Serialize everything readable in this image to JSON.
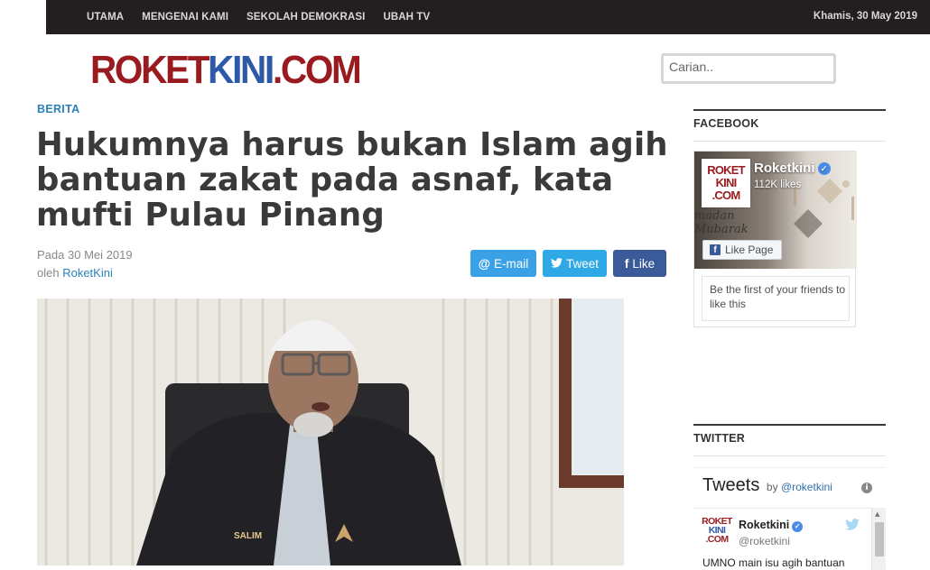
{
  "topbar": {
    "nav": [
      "UTAMA",
      "MENGENAI KAMI",
      "SEKOLAH DEMOKRASI",
      "UBAH TV"
    ],
    "date": "Khamis, 30 May 2019"
  },
  "logo": {
    "part1": "ROKET",
    "part2": "KINI",
    "part3": ".COM"
  },
  "search": {
    "placeholder": "Carian.."
  },
  "article": {
    "category": "BERITA",
    "title": "Hukumnya harus bukan Islam agih bantuan zakat pada asnaf, kata mufti Pulau Pinang",
    "date_prefix": "Pada",
    "date": "30 Mei 2019",
    "author_prefix": "oleh",
    "author": "RoketKini",
    "share": {
      "email": "E-mail",
      "tweet": "Tweet",
      "like": "Like"
    },
    "photo_caption_text": "SALIM"
  },
  "sidebar": {
    "facebook": {
      "heading": "FACEBOOK",
      "page_name": "Roketkini",
      "likes": "112K likes",
      "cover_text": "madan\nMubarak",
      "avatar_line1": "ROKET",
      "avatar_line2": "KINI",
      "avatar_line3": ".COM",
      "like_button": "Like Page",
      "first_friends": "Be the first of your friends to like this"
    },
    "twitter": {
      "heading": "TWITTER",
      "widget_title": "Tweets",
      "by_prefix": "by",
      "by_handle": "@roketkini",
      "user_name": "Roketkini",
      "user_handle": "@roketkini",
      "avatar_line1": "ROKET",
      "avatar_line2": "KINI",
      "avatar_line3": ".COM",
      "tweet_text": "UMNO main isu agih bantuan"
    }
  },
  "colors": {
    "topbar_bg": "#231f20",
    "link_blue": "#2a80b9",
    "logo_red": "#9a1b1f",
    "logo_blue": "#2d5aa8",
    "email_btn": "#3aa1e6",
    "tweet_btn": "#2fa8e6",
    "like_btn": "#3b5a9a"
  }
}
